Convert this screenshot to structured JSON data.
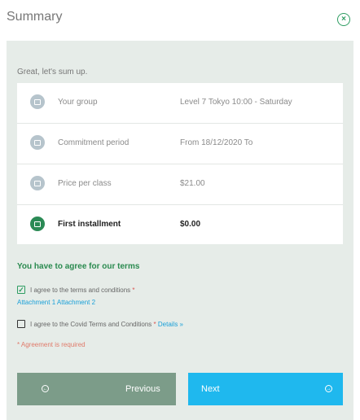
{
  "header": {
    "title": "Summary",
    "close_icon": "close-icon",
    "accent_color": "#2e9d62"
  },
  "intro_text": "Great, let's sum up.",
  "summary_rows": [
    {
      "label": "Your group",
      "value": "Level 7 Tokyo 10:00 - Saturday",
      "icon": "group-icon"
    },
    {
      "label": "Commitment period",
      "value": "From 18/12/2020 To",
      "icon": "calendar-icon"
    },
    {
      "label": "Price per class",
      "value": "$21.00",
      "icon": "price-icon"
    },
    {
      "label": "First installment",
      "value": "$0.00",
      "icon": "installment-icon"
    }
  ],
  "terms": {
    "title": "You have to agree for our terms",
    "items": [
      {
        "label": "I agree to the terms and conditions",
        "required_mark": "*",
        "checked": true
      },
      {
        "label": "I agree to the Covid Terms and Conditions",
        "required_mark": "*",
        "checked": false
      }
    ],
    "attachments": "Attachment 1 Attachment 2",
    "details_link": "Details »",
    "error": "* Agreement is required"
  },
  "buttons": {
    "previous": "Previous",
    "next": "Next",
    "previous_color": "#7c9c89",
    "next_color": "#1fb8ee"
  }
}
